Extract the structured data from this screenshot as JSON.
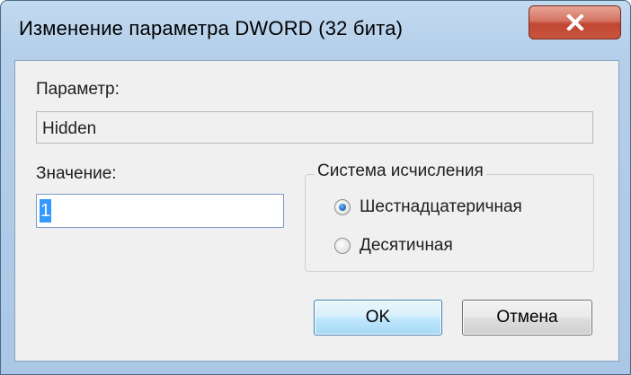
{
  "window": {
    "title": "Изменение параметра DWORD (32 бита)",
    "close_icon": "close-icon"
  },
  "form": {
    "param_label": "Параметр:",
    "param_value": "Hidden",
    "value_label": "Значение:",
    "value": "1",
    "base_group": {
      "title": "Система исчисления",
      "options": [
        {
          "label": "Шестнадцатеричная",
          "checked": true
        },
        {
          "label": "Десятичная",
          "checked": false
        }
      ]
    }
  },
  "buttons": {
    "ok": "OK",
    "cancel": "Отмена"
  },
  "colors": {
    "frame": "#b5cfea",
    "client": "#f0f0f0",
    "close_button": "#c9553d",
    "selection": "#3399ff",
    "default_button_border": "#3c7fb1"
  }
}
